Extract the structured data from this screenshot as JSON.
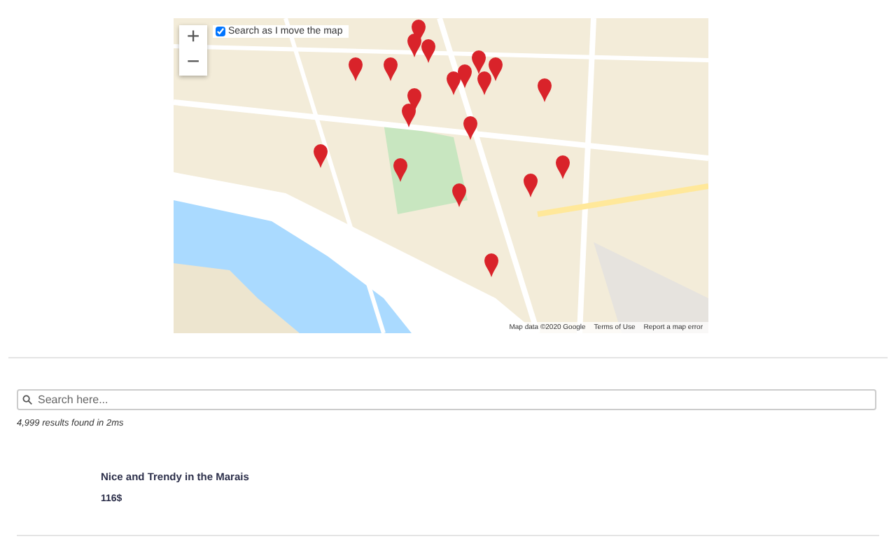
{
  "map": {
    "zoom_in": "+",
    "zoom_out": "−",
    "search_toggle": {
      "label": "Search as I move the map",
      "checked": true
    },
    "footer": [
      "Map data ©2020 Google",
      "Terms of Use",
      "Report a map error"
    ]
  },
  "search": {
    "placeholder": "Search here..."
  },
  "results_info": "4,999 results found in 2ms",
  "listings": [
    {
      "title": "Nice and Trendy in the Marais",
      "price": "116$"
    }
  ]
}
